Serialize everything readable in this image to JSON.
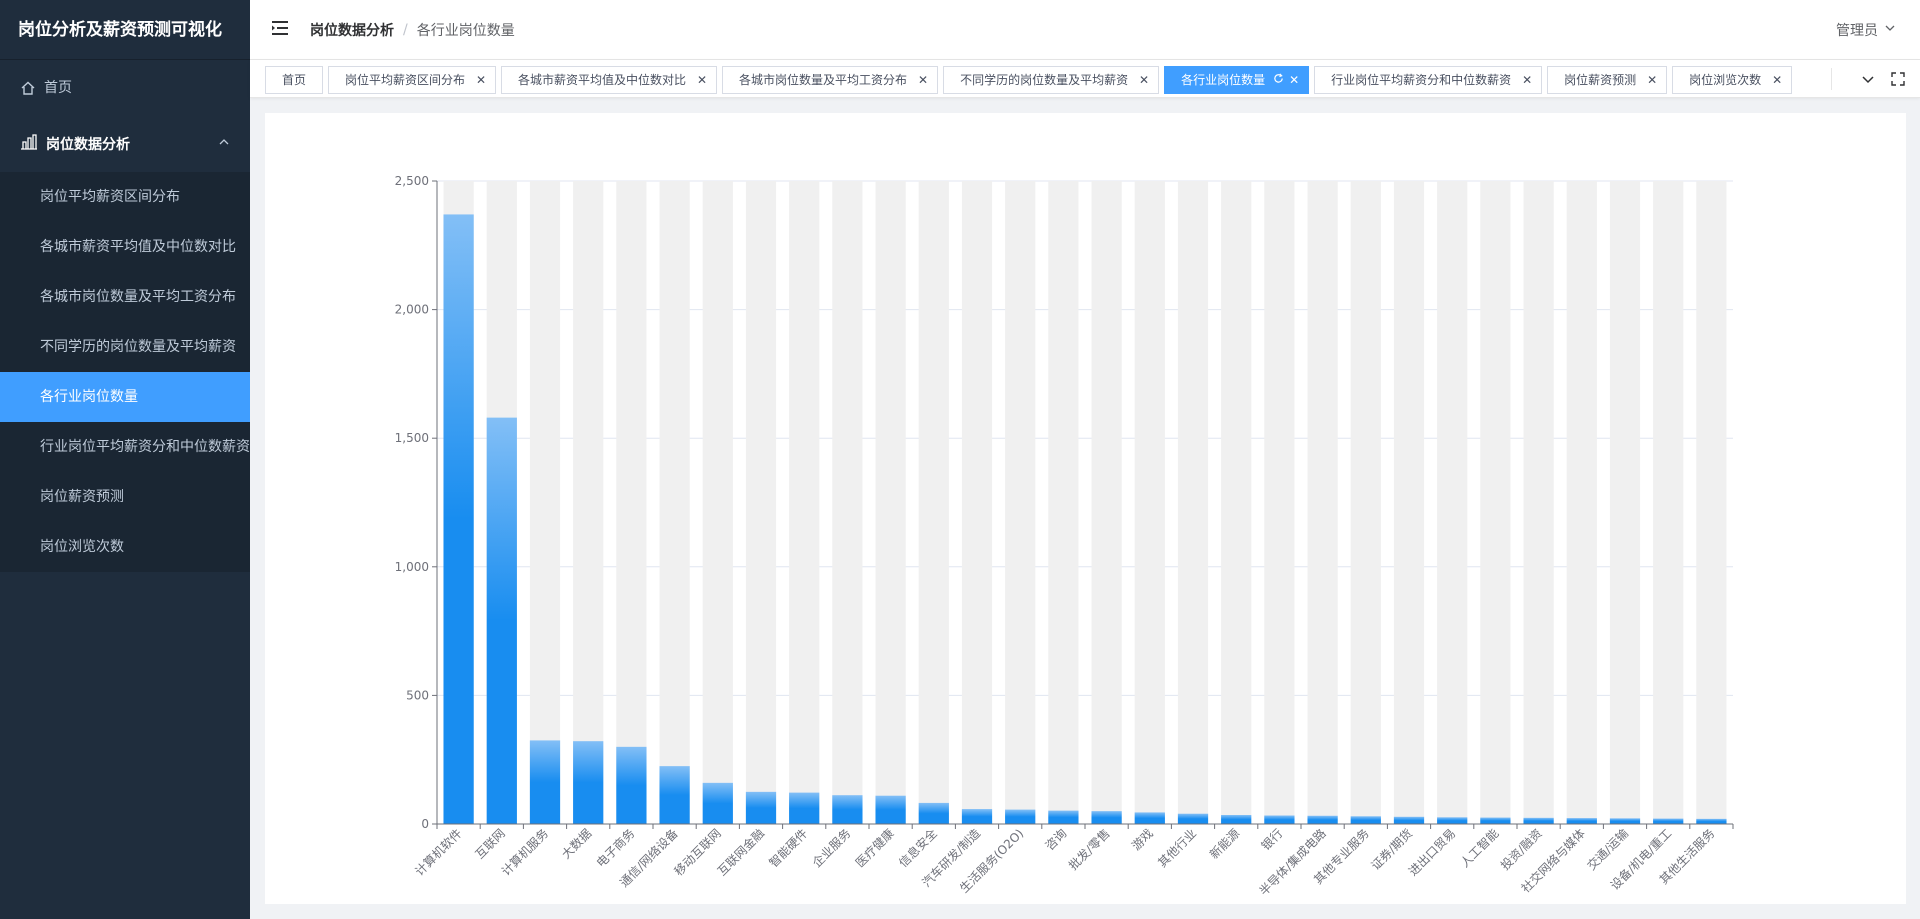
{
  "app": {
    "title": "岗位分析及薪资预测可视化"
  },
  "sidebar": {
    "home": {
      "label": "首页",
      "icon": "home-icon"
    },
    "group": {
      "label": "岗位数据分析",
      "icon": "bar-chart-icon"
    },
    "items": [
      {
        "label": "岗位平均薪资区间分布"
      },
      {
        "label": "各城市薪资平均值及中位数对比"
      },
      {
        "label": "各城市岗位数量及平均工资分布"
      },
      {
        "label": "不同学历的岗位数量及平均薪资"
      },
      {
        "label": "各行业岗位数量"
      },
      {
        "label": "行业岗位平均薪资分和中位数薪资"
      },
      {
        "label": "岗位薪资预测"
      },
      {
        "label": "岗位浏览次数"
      }
    ]
  },
  "header": {
    "breadcrumb": {
      "first": "岗位数据分析",
      "last": "各行业岗位数量"
    },
    "user": "管理员"
  },
  "tabs": [
    {
      "label": "首页"
    },
    {
      "label": "岗位平均薪资区间分布"
    },
    {
      "label": "各城市薪资平均值及中位数对比"
    },
    {
      "label": "各城市岗位数量及平均工资分布"
    },
    {
      "label": "不同学历的岗位数量及平均薪资"
    },
    {
      "label": "各行业岗位数量"
    },
    {
      "label": "行业岗位平均薪资分和中位数薪资"
    },
    {
      "label": "岗位薪资预测"
    },
    {
      "label": "岗位浏览次数"
    }
  ],
  "colors": {
    "accent": "#409eff",
    "bar_top": "#83bff6",
    "bar_bottom": "#188df0",
    "bar_bg": "#f0f0f0",
    "sidebar": "#1f2d3d"
  },
  "chart_data": {
    "type": "bar",
    "categories": [
      "计算机软件",
      "互联网",
      "计算机服务",
      "大数据",
      "电子商务",
      "通信/网络设备",
      "移动互联网",
      "互联网金融",
      "智能硬件",
      "企业服务",
      "医疗健康",
      "信息安全",
      "汽车研发/制造",
      "生活服务(O2O)",
      "咨询",
      "批发/零售",
      "游戏",
      "其他行业",
      "新能源",
      "银行",
      "半导体/集成电路",
      "其他专业服务",
      "证券/期货",
      "进出口贸易",
      "人工智能",
      "投资/融资",
      "社交网络与媒体",
      "交通/运输",
      "设备/机电/重工",
      "其他生活服务"
    ],
    "values": [
      2370,
      1580,
      325,
      322,
      300,
      225,
      160,
      125,
      122,
      112,
      110,
      82,
      58,
      56,
      52,
      50,
      45,
      40,
      35,
      33,
      32,
      30,
      28,
      26,
      25,
      24,
      23,
      22,
      21,
      20
    ],
    "ylim": [
      0,
      2500
    ],
    "yticks": [
      0,
      500,
      1000,
      1500,
      2000,
      2500
    ],
    "ytick_labels": [
      "0",
      "500",
      "1,000",
      "1,500",
      "2,000",
      "2,500"
    ],
    "grid": true,
    "background_bars": true
  }
}
